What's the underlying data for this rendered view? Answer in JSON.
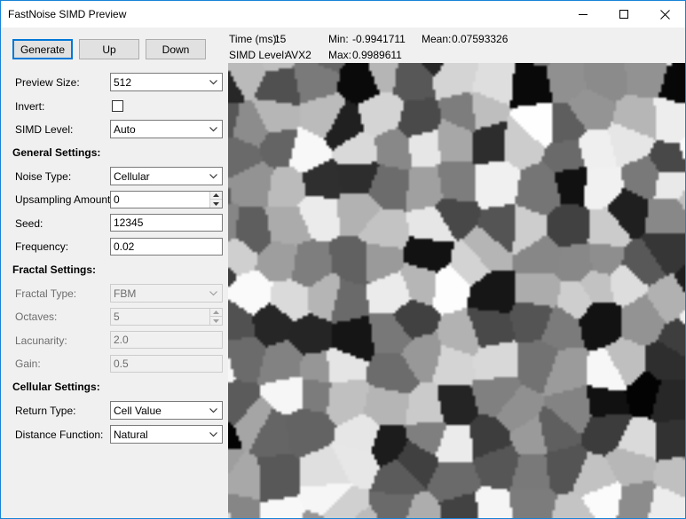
{
  "window": {
    "title": "FastNoise SIMD Preview"
  },
  "toolbar": {
    "generate_label": "Generate",
    "up_label": "Up",
    "down_label": "Down"
  },
  "stats": {
    "time_label": "Time (ms):",
    "time_value": "15",
    "min_label": "Min:",
    "min_value": "-0.9941711",
    "mean_label": "Mean:",
    "mean_value": "0.07593326",
    "simd_label": "SIMD Level:",
    "simd_value": "AVX2",
    "max_label": "Max:",
    "max_value": "0.9989611"
  },
  "preview_settings": {
    "preview_size_label": "Preview Size:",
    "preview_size_value": "512",
    "invert_label": "Invert:",
    "invert_checked": false,
    "simd_level_label": "SIMD Level:",
    "simd_level_value": "Auto"
  },
  "general": {
    "header": "General Settings:",
    "noise_type_label": "Noise Type:",
    "noise_type_value": "Cellular",
    "upsampling_label": "Upsampling Amount:",
    "upsampling_value": "0",
    "seed_label": "Seed:",
    "seed_value": "12345",
    "frequency_label": "Frequency:",
    "frequency_value": "0.02"
  },
  "fractal": {
    "header": "Fractal Settings:",
    "fractal_type_label": "Fractal Type:",
    "fractal_type_value": "FBM",
    "octaves_label": "Octaves:",
    "octaves_value": "5",
    "lacunarity_label": "Lacunarity:",
    "lacunarity_value": "2.0",
    "gain_label": "Gain:",
    "gain_value": "0.5"
  },
  "cellular": {
    "header": "Cellular Settings:",
    "return_type_label": "Return Type:",
    "return_type_value": "Cell Value",
    "distance_function_label": "Distance Function:",
    "distance_function_value": "Natural"
  },
  "colors": {
    "accent": "#0078d7",
    "panel": "#f0f0f0",
    "window_border": "#1883d7"
  }
}
